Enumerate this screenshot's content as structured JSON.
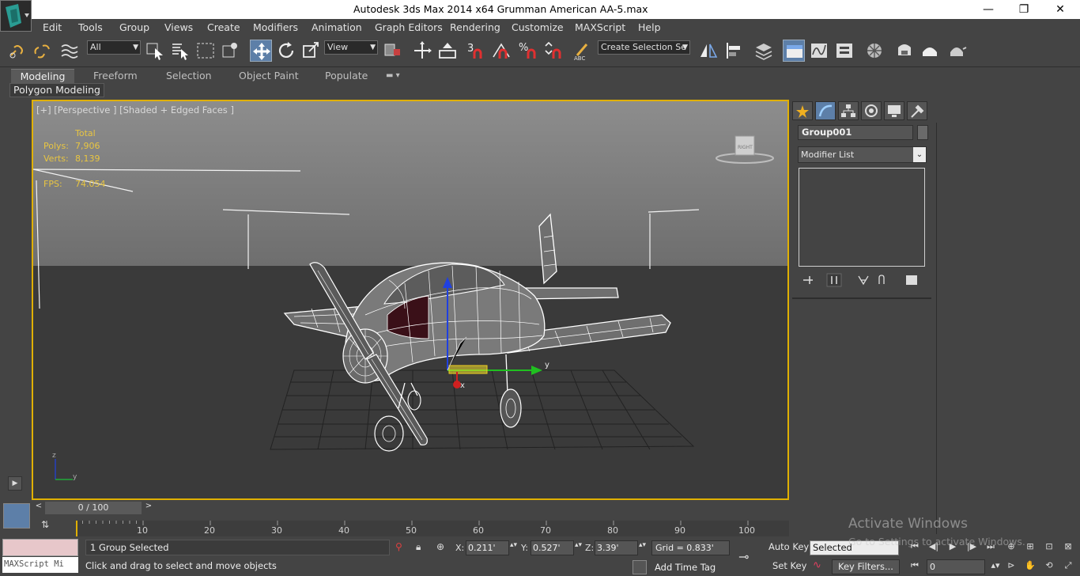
{
  "window": {
    "title": "Autodesk 3ds Max  2014 x64    Grumman American AA-5.max",
    "controls": {
      "minimize": "—",
      "restore": "❐",
      "close": "✕"
    }
  },
  "menu": [
    "Edit",
    "Tools",
    "Group",
    "Views",
    "Create",
    "Modifiers",
    "Animation",
    "Graph Editors",
    "Rendering",
    "Customize",
    "MAXScript",
    "Help"
  ],
  "toolbar": {
    "selection_filter": "All",
    "reference_coord": "View",
    "named_selection_placeholder": "Create Selection Se",
    "snap_toggle": "3",
    "percent_snap": "%"
  },
  "ribbon": {
    "tabs": [
      "Modeling",
      "Freeform",
      "Selection",
      "Object Paint",
      "Populate"
    ],
    "panel_label": "Polygon Modeling"
  },
  "viewport": {
    "label": "[+] [Perspective ] [Shaded + Edged Faces ]",
    "stats": {
      "total_label": "Total",
      "polys_label": "Polys:",
      "polys_value": "7,906",
      "verts_label": "Verts:",
      "verts_value": "8,139",
      "fps_label": "FPS:",
      "fps_value": "74.054"
    },
    "viewcube_face": "RIGHT",
    "gizmo_axes": {
      "x": "x",
      "y": "y"
    },
    "corner_axes": {
      "z": "z",
      "y": "y"
    }
  },
  "command_panel": {
    "object_name": "Group001",
    "modifier_list": "Modifier List"
  },
  "timeline": {
    "frame_counter": "0 / 100",
    "ticks": [
      "10",
      "20",
      "30",
      "40",
      "50",
      "60",
      "70",
      "80",
      "90",
      "100"
    ]
  },
  "status": {
    "maxscript_mini": "MAXScript Mi",
    "selection_info": "1 Group Selected",
    "prompt": "Click and drag to select and move objects",
    "x_label": "X:",
    "x_value": "0.211'",
    "y_label": "Y:",
    "y_value": "0.527'",
    "z_label": "Z:",
    "z_value": "3.39'",
    "grid": "Grid = 0.833'",
    "add_time_tag": "Add Time Tag",
    "auto_key": "Auto Key",
    "set_key": "Set Key",
    "selected_dropdown": "Selected",
    "key_filters": "Key Filters...",
    "current_frame": "0"
  },
  "watermark": {
    "line1": "Activate Windows",
    "line2": "Go to Settings to activate Windows."
  },
  "colors": {
    "ui_bg": "#444444",
    "viewport_border": "#e0b000",
    "stat_text": "#e8c542",
    "wireframe": "#ffffff",
    "axis_x": "#d02020",
    "axis_y": "#20c020",
    "axis_z": "#2040e0"
  }
}
